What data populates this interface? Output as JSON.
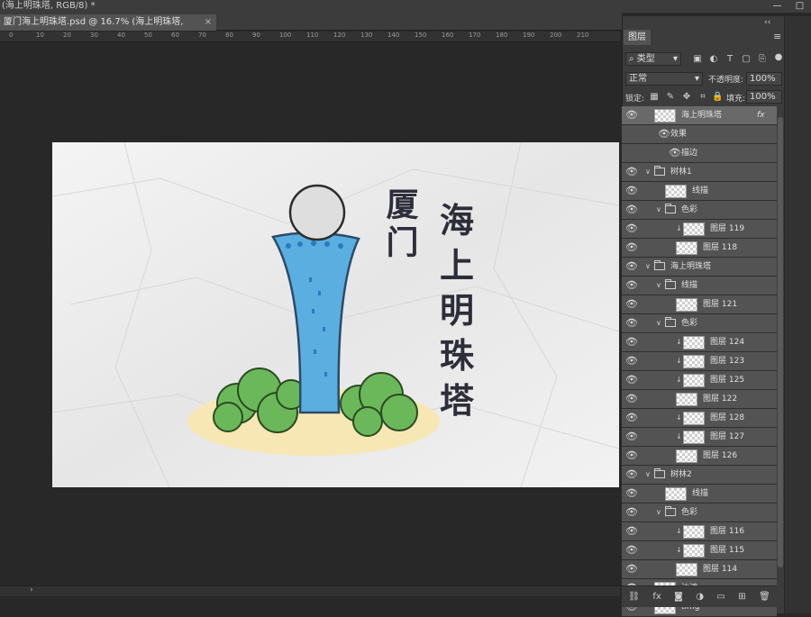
{
  "window": {
    "title": "(海上明珠塔, RGB/8) *",
    "controls": [
      "—",
      "□"
    ]
  },
  "document_tab": {
    "label": "厦门海上明珠塔.psd @ 16.7% (海上明珠塔, RGB/8) *",
    "close": "×"
  },
  "ruler": {
    "ticks": [
      "0",
      "10",
      "20",
      "30",
      "40",
      "50",
      "60",
      "70",
      "80",
      "90",
      "100",
      "110",
      "120",
      "130",
      "140",
      "150",
      "160",
      "170",
      "180",
      "190",
      "200",
      "210"
    ]
  },
  "status": {
    "arrow": "›"
  },
  "layers_panel": {
    "tab_label": "图层",
    "collapse": "‹‹",
    "menu": "≡",
    "filter": {
      "label": "类型",
      "icon": "search-icon"
    },
    "blend_mode": "正常",
    "opacity_label": "不透明度:",
    "opacity_value": "100%",
    "lock_label": "锁定:",
    "fill_label": "填充:",
    "fill_value": "100%",
    "layers": [
      {
        "name": "海上明珠塔",
        "level": 0,
        "type": "layer",
        "fx": "fx",
        "selected": true
      },
      {
        "name": "效果",
        "level": 1,
        "type": "effect"
      },
      {
        "name": "描边",
        "level": 2,
        "type": "effect"
      },
      {
        "name": "树林1",
        "level": 0,
        "type": "group"
      },
      {
        "name": "线描",
        "level": 1,
        "type": "layer"
      },
      {
        "name": "色彩",
        "level": 1,
        "type": "group"
      },
      {
        "name": "图层 119",
        "level": 2,
        "type": "clip"
      },
      {
        "name": "图层 118",
        "level": 2,
        "type": "layer"
      },
      {
        "name": "海上明珠塔",
        "level": 0,
        "type": "group"
      },
      {
        "name": "线描",
        "level": 1,
        "type": "group"
      },
      {
        "name": "图层 121",
        "level": 2,
        "type": "layer"
      },
      {
        "name": "色彩",
        "level": 1,
        "type": "group"
      },
      {
        "name": "图层 124",
        "level": 2,
        "type": "clip"
      },
      {
        "name": "图层 123",
        "level": 2,
        "type": "clip"
      },
      {
        "name": "图层 125",
        "level": 2,
        "type": "clip"
      },
      {
        "name": "图层 122",
        "level": 2,
        "type": "layer"
      },
      {
        "name": "图层 128",
        "level": 2,
        "type": "clip"
      },
      {
        "name": "图层 127",
        "level": 2,
        "type": "clip"
      },
      {
        "name": "图层 126",
        "level": 2,
        "type": "layer"
      },
      {
        "name": "树林2",
        "level": 0,
        "type": "group"
      },
      {
        "name": "线描",
        "level": 1,
        "type": "layer"
      },
      {
        "name": "色彩",
        "level": 1,
        "type": "group"
      },
      {
        "name": "图层 116",
        "level": 2,
        "type": "clip"
      },
      {
        "name": "图层 115",
        "level": 2,
        "type": "clip"
      },
      {
        "name": "图层 114",
        "level": 2,
        "type": "layer"
      },
      {
        "name": "沙滩",
        "level": 0,
        "type": "layer"
      },
      {
        "name": "timg",
        "level": 0,
        "type": "layer"
      }
    ],
    "footer_icons": [
      "link-icon",
      "fx-icon",
      "mask-icon",
      "adjustment-icon",
      "new-group-icon",
      "new-layer-icon",
      "trash-icon"
    ]
  },
  "artwork": {
    "title_left": "厦门",
    "title_chars": [
      "海",
      "上",
      "明",
      "珠",
      "塔"
    ],
    "colors": {
      "tower": "#5aaee0",
      "tower_dots": "#2a7bbd",
      "bush": "#6bb85a",
      "sand": "#f7e7b5",
      "paper": "#efefef"
    }
  }
}
